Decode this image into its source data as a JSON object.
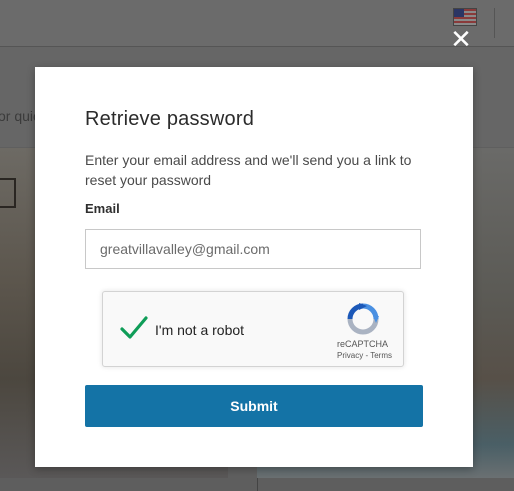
{
  "background": {
    "partial_text": "or quic",
    "flag_icon": "us-flag-icon"
  },
  "modal": {
    "title": "Retrieve password",
    "description": "Enter your email address and we'll send you a link to reset your password",
    "email_label": "Email",
    "email_value": "greatvillavalley@gmail.com",
    "close_icon": "close-icon"
  },
  "recaptcha": {
    "checked": true,
    "label": "I'm not a robot",
    "brand": "reCAPTCHA",
    "privacy": "Privacy",
    "separator": " - ",
    "terms": "Terms"
  },
  "submit_label": "Submit",
  "colors": {
    "accent": "#1473a6",
    "check": "#0f9d58"
  }
}
